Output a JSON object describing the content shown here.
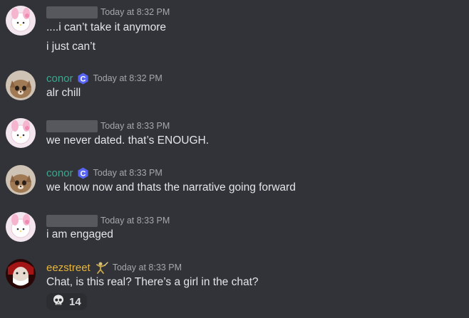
{
  "messages": [
    {
      "author": "",
      "timestamp": "Today at 8:32 PM",
      "lines": [
        "....i can’t take it anymore",
        "i just can’t"
      ],
      "avatar": "sanrio-icon"
    },
    {
      "author": "conor",
      "badge": "c-badge-icon",
      "timestamp": "Today at 8:32 PM",
      "lines": [
        "alr chill"
      ],
      "avatar": "cat-photo-icon"
    },
    {
      "author": "",
      "timestamp": "Today at 8:33 PM",
      "lines": [
        "we never dated. that’s ENOUGH."
      ],
      "avatar": "sanrio-icon"
    },
    {
      "author": "conor",
      "badge": "c-badge-icon",
      "timestamp": "Today at 8:33 PM",
      "lines": [
        "we know now and thats the narrative going forward"
      ],
      "avatar": "cat-photo-icon"
    },
    {
      "author": "",
      "timestamp": "Today at 8:33 PM",
      "lines": [
        "i am engaged"
      ],
      "avatar": "sanrio-icon"
    },
    {
      "author": "eezstreet",
      "badge": "figure-badge-icon",
      "timestamp": "Today at 8:33 PM",
      "lines": [
        "Chat, is this real? There’s a girl in the chat?"
      ],
      "avatar": "masked-avatar-icon",
      "reaction": {
        "emoji": "skull-icon",
        "count": "14"
      }
    }
  ],
  "colors": {
    "background": "#313338",
    "conor_name": "#3ba88f",
    "eezstreet_name": "#e7b53c",
    "timestamp": "#a4a7ad",
    "text": "#e3e5e8"
  }
}
